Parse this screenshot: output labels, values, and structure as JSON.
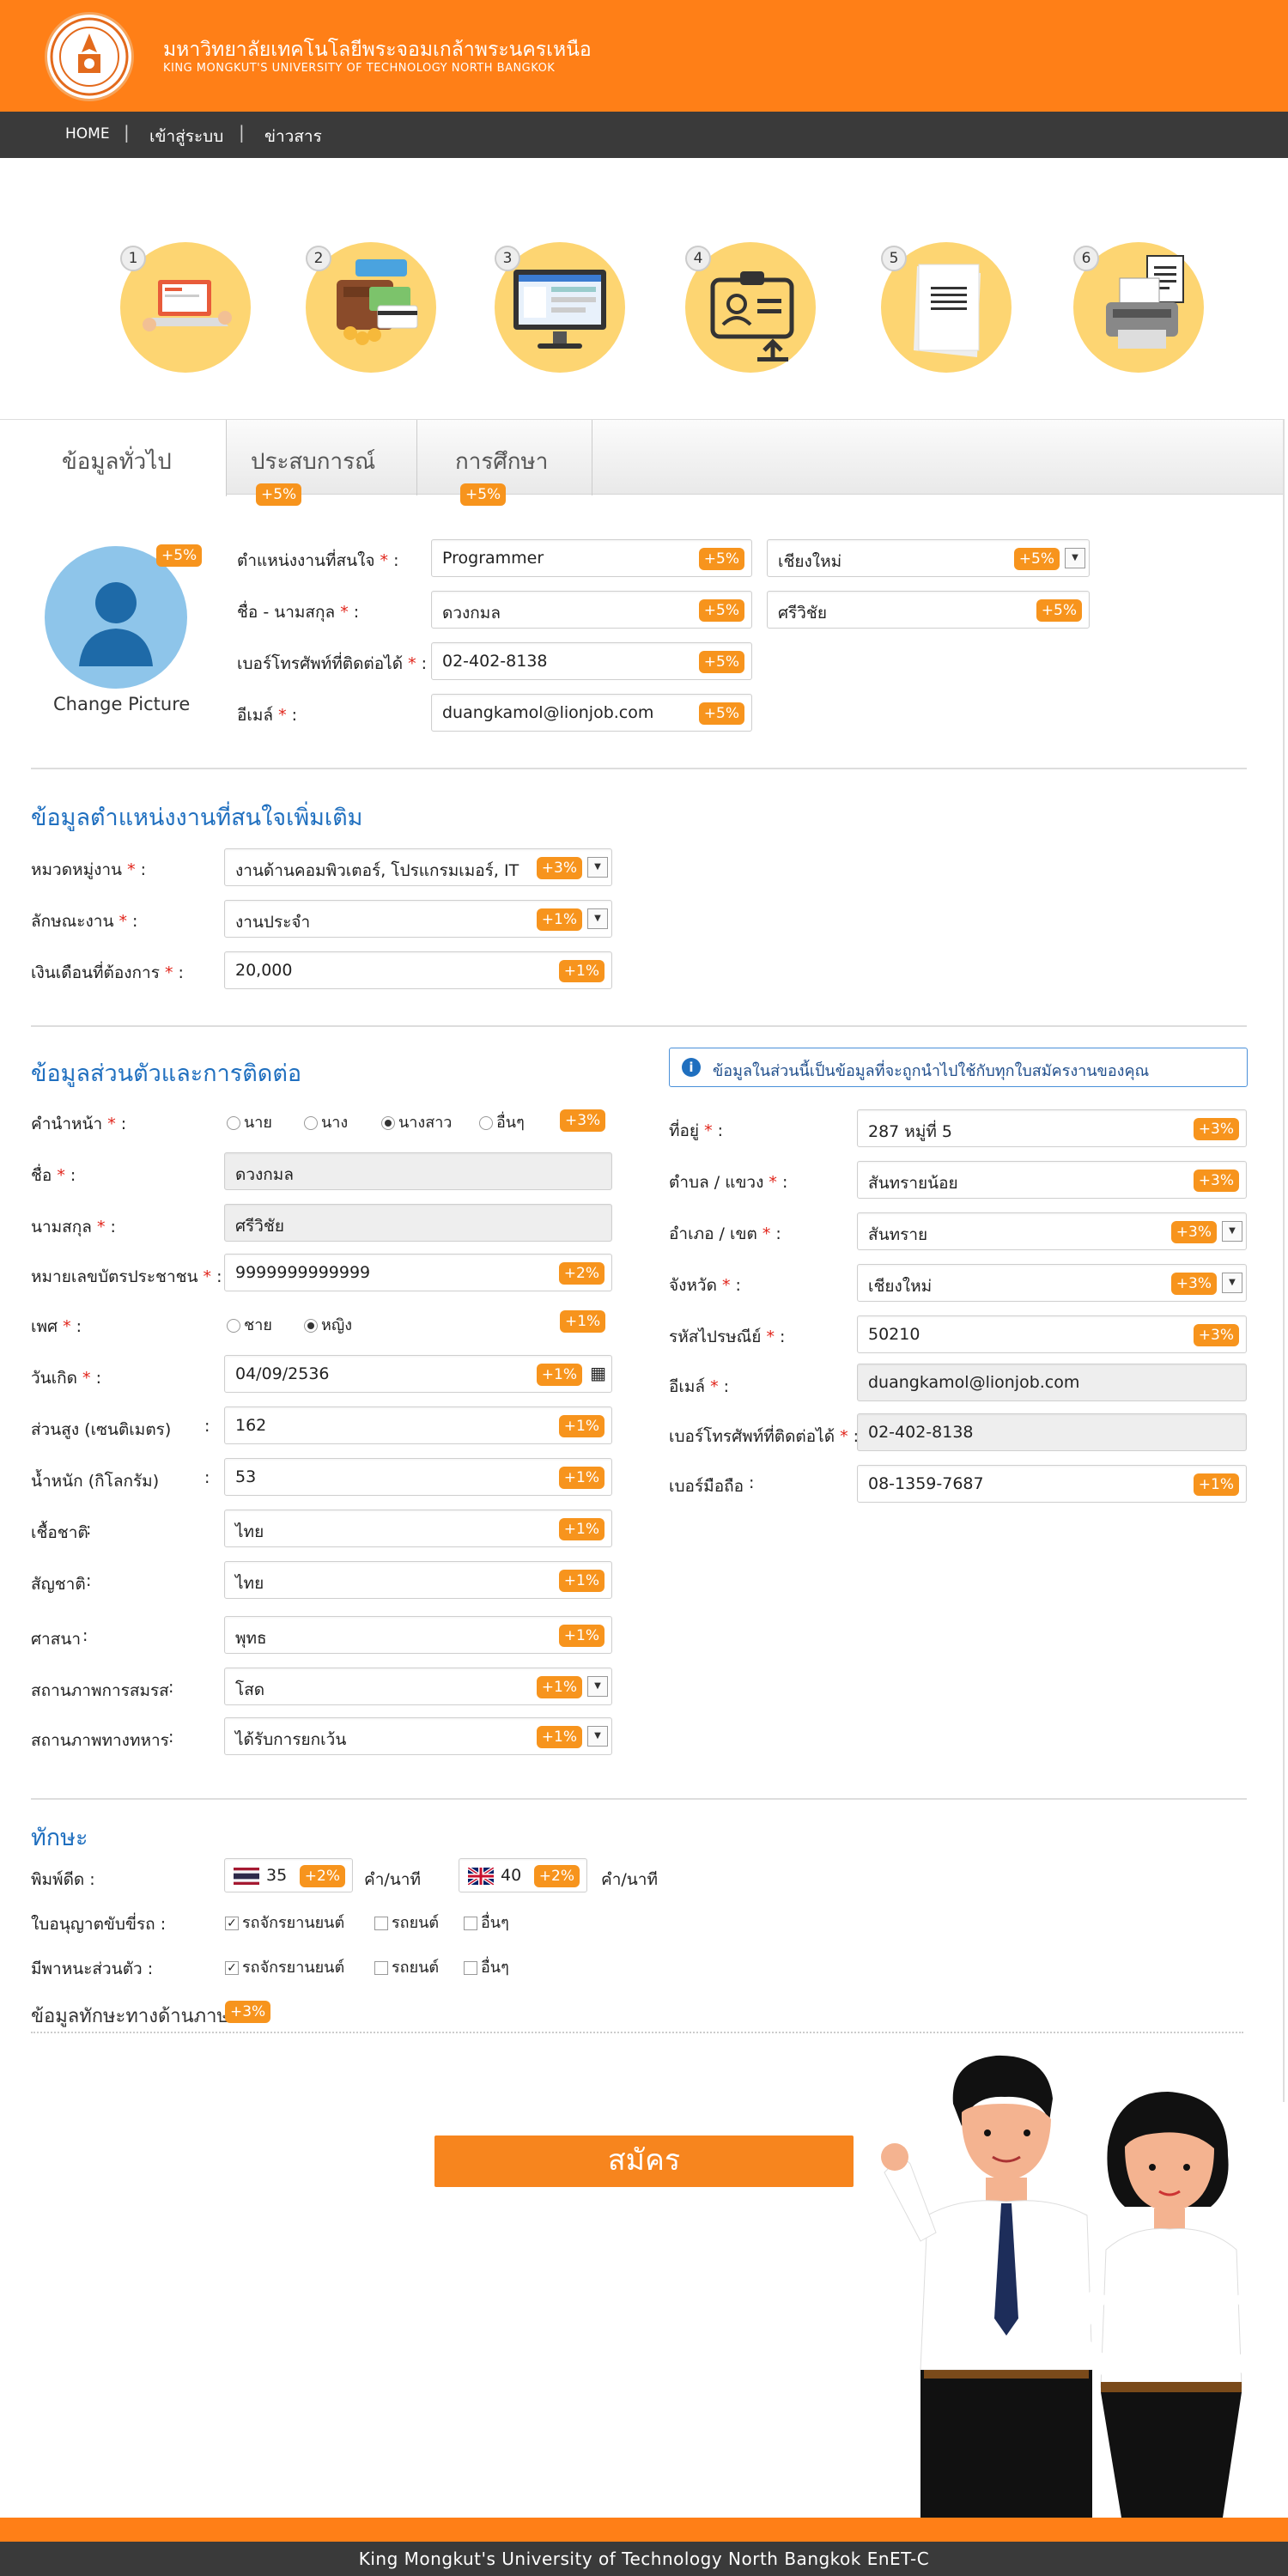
{
  "header": {
    "university_th": "มหาวิทยาลัยเทคโนโลยีพระจอมเกล้าพระนครเหนือ",
    "university_en": "KING MONGKUT'S UNIVERSITY OF TECHNOLOGY NORTH BANGKOK"
  },
  "nav": {
    "items": [
      "HOME",
      "เข้าสู่ระบบ",
      "ข่าวสาร"
    ],
    "separator": "|"
  },
  "steps": [
    "1",
    "2",
    "3",
    "4",
    "5",
    "6"
  ],
  "tabs": [
    {
      "label": "ข้อมูลทั่วไป",
      "badge": ""
    },
    {
      "label": "ประสบการณ์",
      "badge": "+5%"
    },
    {
      "label": "การศึกษา",
      "badge": "+5%"
    }
  ],
  "profile": {
    "picture_badge": "+5%",
    "change_picture": "Change Picture",
    "position_label": "ตำแหน่งงานที่สนใจ",
    "position_value": "Programmer",
    "position_badge": "+5%",
    "province_value": "เชียงใหม่",
    "province_badge": "+5%",
    "name_label": "ชื่อ - นามสกุล",
    "firstname": "ดวงกมล",
    "firstname_badge": "+5%",
    "lastname": "ศรีวิชัย",
    "lastname_badge": "+5%",
    "phone_label": "เบอร์โทรศัพท์ที่ติดต่อได้",
    "phone_value": "02-402-8138",
    "phone_badge": "+5%",
    "email_label": "อีเมล์",
    "email_value": "duangkamol@lionjob.com",
    "email_badge": "+5%"
  },
  "job_section": {
    "title": "ข้อมูลตำแหน่งงานที่สนใจเพิ่มเติม",
    "category_label": "หมวดหมู่งาน",
    "category_value": "งานด้านคอมพิวเตอร์, โปรแกรมเมอร์, IT",
    "category_badge": "+3%",
    "type_label": "ลักษณะงาน",
    "type_value": "งานประจำ",
    "type_badge": "+1%",
    "salary_label": "เงินเดือนที่ต้องการ",
    "salary_value": "20,000",
    "salary_badge": "+1%"
  },
  "personal": {
    "title": "ข้อมูลส่วนตัวและการติดต่อ",
    "info_note": "ข้อมูลในส่วนนี้เป็นข้อมูลที่จะถูกนำไปใช้กับทุกใบสมัครงานของคุณ",
    "prefix_label": "คำนำหน้า",
    "prefix_options": [
      "นาย",
      "นาง",
      "นางสาว",
      "อื่นๆ"
    ],
    "prefix_selected": "นางสาว",
    "prefix_badge": "+3%",
    "firstname_label": "ชื่อ",
    "firstname_value": "ดวงกมล",
    "lastname_label": "นามสกุล",
    "lastname_value": "ศรีวิชัย",
    "id_label": "หมายเลขบัตรประชาชน",
    "id_value": "9999999999999",
    "id_badge": "+2%",
    "gender_label": "เพศ",
    "gender_options": [
      "ชาย",
      "หญิง"
    ],
    "gender_selected": "หญิง",
    "gender_badge": "+1%",
    "birth_label": "วันเกิด",
    "birth_value": "04/09/2536",
    "birth_badge": "+1%",
    "height_label": "ส่วนสูง (เซนติเมตร)",
    "height_value": "162",
    "height_badge": "+1%",
    "weight_label": "น้ำหนัก (กิโลกรัม)",
    "weight_value": "53",
    "weight_badge": "+1%",
    "race_label": "เชื้อชาติ",
    "race_value": "ไทย",
    "race_badge": "+1%",
    "nationality_label": "สัญชาติ",
    "nationality_value": "ไทย",
    "nationality_badge": "+1%",
    "religion_label": "ศาสนา",
    "religion_value": "พุทธ",
    "religion_badge": "+1%",
    "marital_label": "สถานภาพการสมรส",
    "marital_value": "โสด",
    "marital_badge": "+1%",
    "military_label": "สถานภาพทางทหาร",
    "military_value": "ได้รับการยกเว้น",
    "military_badge": "+1%",
    "address_label": "ที่อยู่",
    "address_value": "287 หมู่ที่ 5",
    "address_badge": "+3%",
    "subdistrict_label": "ตำบล / แขวง",
    "subdistrict_value": "สันทรายน้อย",
    "subdistrict_badge": "+3%",
    "district_label": "อำเภอ / เขต",
    "district_value": "สันทราย",
    "district_badge": "+3%",
    "province_label": "จังหวัด",
    "province_value": "เชียงใหม่",
    "province_badge": "+3%",
    "postal_label": "รหัสไปรษณีย์",
    "postal_value": "50210",
    "postal_badge": "+3%",
    "email_label": "อีเมล์",
    "email_value": "duangkamol@lionjob.com",
    "phone_label": "เบอร์โทรศัพท์ที่ติดต่อได้",
    "phone_value": "02-402-8138",
    "mobile_label": "เบอร์มือถือ",
    "mobile_value": "08-1359-7687",
    "mobile_badge": "+1%"
  },
  "skills": {
    "title": "ทักษะ",
    "typing_label": "พิมพ์ดีด",
    "typing_th_value": "35",
    "typing_th_badge": "+2%",
    "typing_en_value": "40",
    "typing_en_badge": "+2%",
    "wpm_unit": "คำ/นาที",
    "license_label": "ใบอนุญาตขับขี่รถ",
    "vehicle_label": "มีพาหนะส่วนตัว",
    "vehicle_options": [
      "รถจักรยานยนต์",
      "รถยนต์",
      "อื่นๆ"
    ],
    "language_title": "ข้อมูลทักษะทางด้านภาษา",
    "language_badge": "+3%"
  },
  "submit_label": "สมัคร",
  "footer_text": "King Mongkut's University of Technology North Bangkok EnET-C",
  "colors": {
    "primary_orange": "#ff7f17",
    "badge_orange": "#f7941d",
    "nav_dark": "#3a3a3a",
    "section_blue": "#1f6fbf",
    "step_yellow": "#fdd572"
  }
}
